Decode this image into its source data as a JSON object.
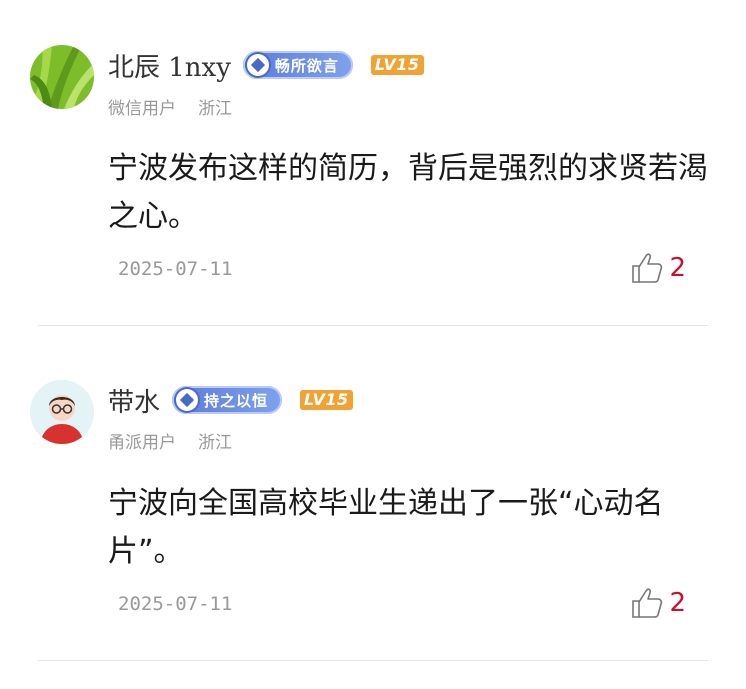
{
  "comments": [
    {
      "username": "北辰 1nxy",
      "title_badge": "畅所欲言",
      "level_badge": "LV15",
      "user_type": "微信用户",
      "location": "浙江",
      "content": "宁波发布这样的简历，背后是强烈的求贤若渴之心。",
      "date": "2025-07-11",
      "likes": "2",
      "avatar_icon": "green-leaves-avatar"
    },
    {
      "username": "带水",
      "title_badge": "持之以恒",
      "level_badge": "LV15",
      "user_type": "甬派用户",
      "location": "浙江",
      "content": "宁波向全国高校毕业生递出了一张“心动名片”。",
      "date": "2025-07-11",
      "likes": "2",
      "avatar_icon": "cartoon-person-avatar"
    }
  ],
  "colors": {
    "like_count": "#c8102e",
    "badge": "#5b7bd8",
    "level": "#f0a232"
  }
}
